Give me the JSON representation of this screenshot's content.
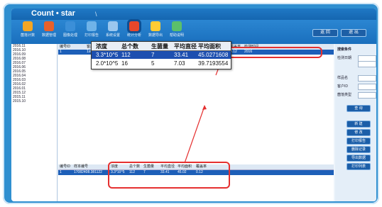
{
  "app": {
    "title": "Count • star",
    "tab_mark": "\\"
  },
  "toolbar": {
    "tools": [
      {
        "label": "菌落计数",
        "color": "#f5a623"
      },
      {
        "label": "数据管理",
        "color": "#e8612c"
      },
      {
        "label": "图像处理",
        "color": "#3b8fd8"
      },
      {
        "label": "打印报告",
        "color": "#6fb3e8"
      },
      {
        "label": "系统设置",
        "color": "#9ac7ee"
      },
      {
        "label": "统计分析",
        "color": "#e6472b"
      },
      {
        "label": "数据导出",
        "color": "#ffcc33"
      },
      {
        "label": "帮助说明",
        "color": "#5bc06a"
      }
    ],
    "right_buttons": [
      "返 回",
      "退 出"
    ]
  },
  "datelist": [
    "2016.11",
    "2016.10",
    "2016.09",
    "2016.08",
    "2016.07",
    "2016.06",
    "2016.05",
    "2016.04",
    "2016.03",
    "2016.02",
    "2016.01",
    "2015.12",
    "2015.11",
    "2015.10"
  ],
  "top_grid": {
    "headers": [
      "编号ID",
      "客户ID",
      "菌落类型",
      "浓度",
      "总个数",
      "生菌量",
      "平均直径",
      "平均面积",
      "覆盖率",
      "检测时间"
    ],
    "selected_row": [
      "1",
      "1st",
      "",
      "3.3*10^5",
      "112",
      "7",
      "33.41",
      "45.02",
      "0.12",
      "2016"
    ]
  },
  "zoom": {
    "headers": [
      "浓度",
      "总个数",
      "生菌量",
      "平均直径",
      "平均面积"
    ],
    "row1": [
      "3.3*10^5",
      "112",
      "7",
      "33.41",
      "45.0271608"
    ],
    "row2": [
      "2.0*10^5",
      "16",
      "5",
      "7.03",
      "39.7193554"
    ]
  },
  "bottom_grid": {
    "headers": [
      "编号ID",
      "样本编号",
      "浓度",
      "总个数",
      "生菌量",
      "平均直径",
      "平均面积",
      "覆盖率"
    ],
    "row": [
      "1",
      "17082408.381122",
      "3.3*10^5",
      "112",
      "7",
      "33.41",
      "45.02",
      "0.12"
    ]
  },
  "panel": {
    "title": "搜索条件",
    "labels": [
      "检测日期",
      "",
      "样品名",
      "客户ID",
      "菌落类型"
    ],
    "buttons": [
      "查 询",
      "新 建",
      "修 改",
      "打印报告",
      "删除记录",
      "导出数据",
      "打印列表"
    ]
  }
}
